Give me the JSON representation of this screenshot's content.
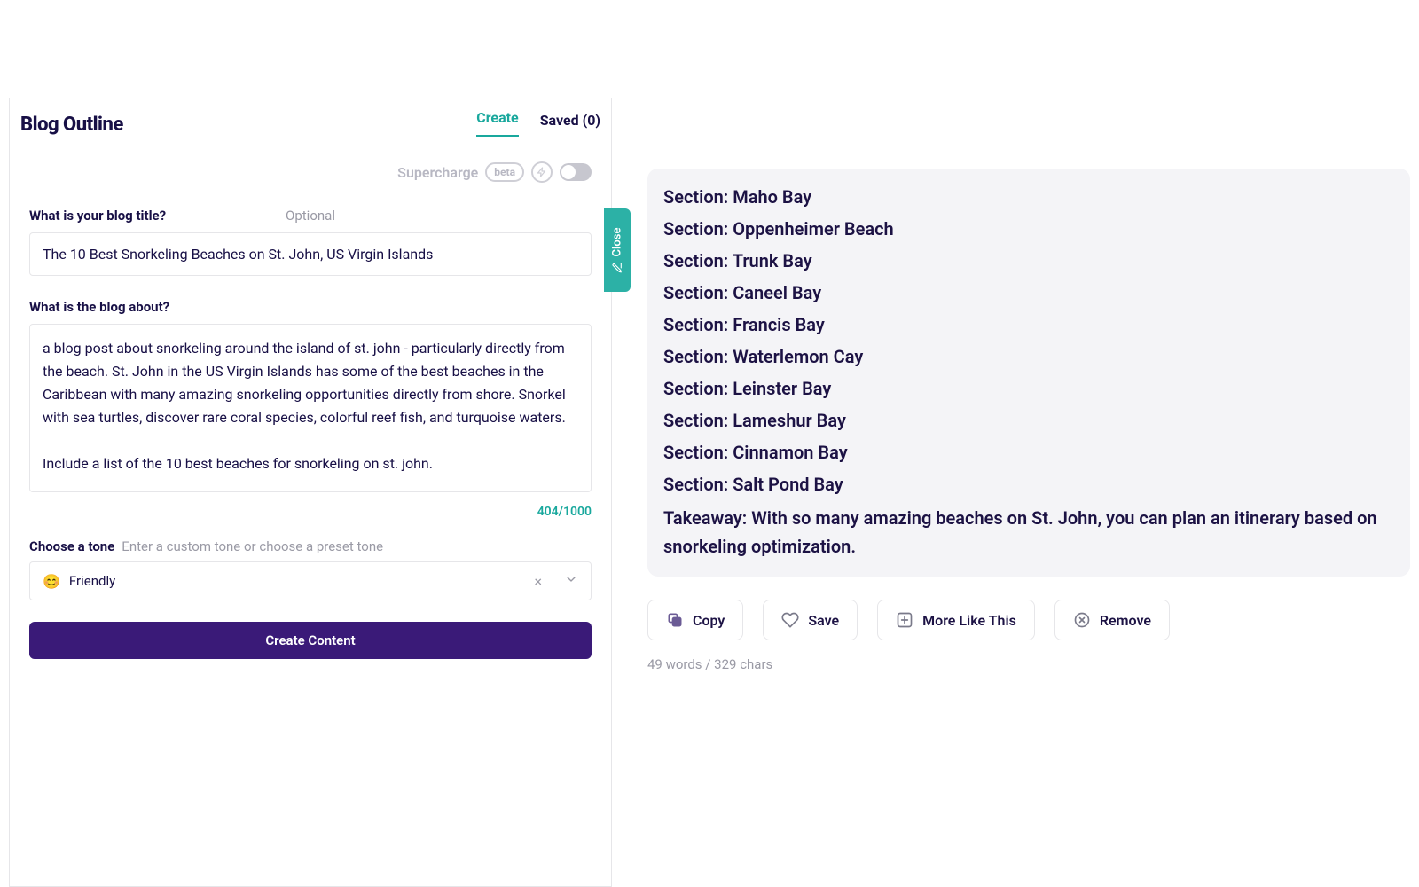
{
  "header": {
    "title": "Blog Outline",
    "tabs": {
      "create": "Create",
      "saved": "Saved (0)"
    }
  },
  "supercharge": {
    "label": "Supercharge",
    "beta": "beta"
  },
  "close": {
    "label": "Close"
  },
  "form": {
    "title_label": "What is your blog title?",
    "optional": "Optional",
    "title_value": "The 10 Best Snorkeling Beaches on St. John, US Virgin Islands",
    "about_label": "What is the blog about?",
    "about_value": "a blog post about snorkeling around the island of st. john - particularly directly from the beach. St. John in the US Virgin Islands has some of the best beaches in the Caribbean with many amazing snorkeling opportunities directly from shore. Snorkel with sea turtles, discover rare coral species, colorful reef fish, and turquoise waters.\n\nInclude a list of the 10 best beaches for snorkeling on st. john.",
    "char_count": "404/1000",
    "tone_label": "Choose a tone",
    "tone_hint": "Enter a custom tone or choose a preset tone",
    "tone_emoji": "😊",
    "tone_value": "Friendly",
    "cta": "Create Content"
  },
  "output": {
    "sections": [
      "Section: Maho Bay",
      "Section: Oppenheimer Beach",
      "Section: Trunk Bay",
      "Section: Caneel Bay",
      "Section: Francis Bay",
      "Section: Waterlemon Cay",
      "Section: Leinster Bay",
      "Section: Lameshur Bay",
      "Section: Cinnamon Bay",
      "Section: Salt Pond Bay"
    ],
    "takeaway": "Takeaway: With so many amazing beaches on St. John, you can plan an itinerary based on snorkeling optimization."
  },
  "actions": {
    "copy": "Copy",
    "save": "Save",
    "more": "More Like This",
    "remove": "Remove"
  },
  "meta": "49 words / 329 chars"
}
